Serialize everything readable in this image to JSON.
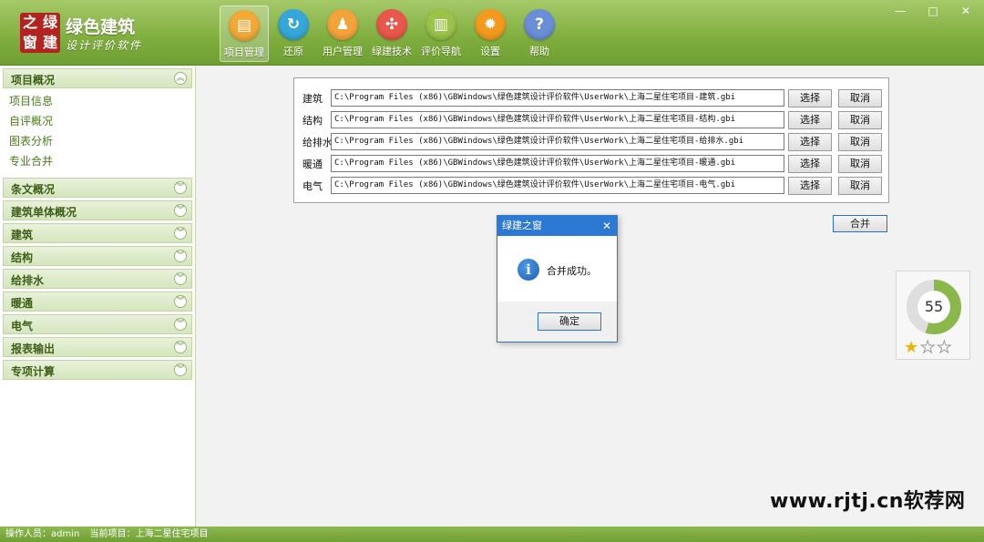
{
  "header": {
    "logo_chars": [
      "之",
      "绿",
      "窗",
      "建"
    ],
    "title": "绿色建筑",
    "subtitle": "设计评价软件",
    "toolbar": [
      {
        "label": "项目管理",
        "icon": "folder-icon",
        "color": "#f3a935",
        "glyph": "▤"
      },
      {
        "label": "还原",
        "icon": "refresh-icon",
        "color": "#35a7d9",
        "glyph": "↻"
      },
      {
        "label": "用户管理",
        "icon": "users-icon",
        "color": "#f2a33a",
        "glyph": "♟"
      },
      {
        "label": "绿建技术",
        "icon": "network-icon",
        "color": "#e8574b",
        "glyph": "✣"
      },
      {
        "label": "评价导航",
        "icon": "book-icon",
        "color": "#9bc24a",
        "glyph": "▥"
      },
      {
        "label": "设置",
        "icon": "gear-icon",
        "color": "#f39a1e",
        "glyph": "✹"
      },
      {
        "label": "帮助",
        "icon": "help-icon",
        "color": "#6a8ed8",
        "glyph": "?"
      }
    ],
    "window_controls": {
      "minimize": "—",
      "maximize": "□",
      "close": "✕"
    }
  },
  "sidebar": {
    "sections": [
      {
        "label": "项目概况",
        "expanded": true,
        "items": [
          "项目信息",
          "自评概况",
          "图表分析",
          "专业合并"
        ]
      },
      {
        "label": "条文概况"
      },
      {
        "label": "建筑单体概况"
      },
      {
        "label": "建筑"
      },
      {
        "label": "结构"
      },
      {
        "label": "给排水"
      },
      {
        "label": "暖通"
      },
      {
        "label": "电气"
      },
      {
        "label": "报表输出"
      },
      {
        "label": "专项计算"
      }
    ],
    "chev_up": "︽",
    "chev_down": "︾"
  },
  "files": {
    "rows": [
      {
        "label": "建筑",
        "path": "C:\\Program Files (x86)\\GBWindows\\绿色建筑设计评价软件\\UserWork\\上海二星住宅项目-建筑.gbi"
      },
      {
        "label": "结构",
        "path": "C:\\Program Files (x86)\\GBWindows\\绿色建筑设计评价软件\\UserWork\\上海二星住宅项目-结构.gbi"
      },
      {
        "label": "给排水",
        "path": "C:\\Program Files (x86)\\GBWindows\\绿色建筑设计评价软件\\UserWork\\上海二星住宅项目-给排水.gbi"
      },
      {
        "label": "暖通",
        "path": "C:\\Program Files (x86)\\GBWindows\\绿色建筑设计评价软件\\UserWork\\上海二星住宅项目-暖通.gbi"
      },
      {
        "label": "电气",
        "path": "C:\\Program Files (x86)\\GBWindows\\绿色建筑设计评价软件\\UserWork\\上海二星住宅项目-电气.gbi"
      }
    ],
    "select_label": "选择",
    "cancel_label": "取消",
    "merge_label": "合并"
  },
  "score": {
    "value": "55",
    "fraction": 0.55,
    "stars_total": 3,
    "stars_filled": 1,
    "ring_color": "#8ab84b"
  },
  "dialog": {
    "title": "绿建之窗",
    "close": "✕",
    "icon_glyph": "i",
    "message": "合并成功。",
    "ok_label": "确定"
  },
  "status": {
    "operator": "操作人员：admin",
    "project": "当前项目：上海二星住宅项目"
  },
  "watermark": "www.rjtj.cn软荐网"
}
